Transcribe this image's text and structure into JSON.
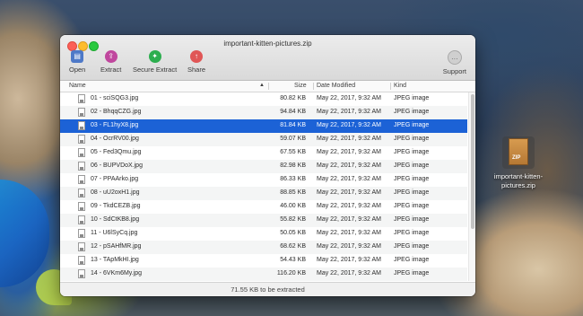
{
  "window": {
    "title": "important-kitten-pictures.zip"
  },
  "toolbar": {
    "open": "Open",
    "extract": "Extract",
    "secure_extract": "Secure Extract",
    "share": "Share",
    "support": "Support"
  },
  "columns": {
    "name": "Name",
    "size": "Size",
    "date": "Date Modified",
    "kind": "Kind"
  },
  "files": [
    {
      "name": "01 - sciSQG3.jpg",
      "size": "80.82 KB",
      "date": "May 22, 2017, 9:32 AM",
      "kind": "JPEG image"
    },
    {
      "name": "02 - BhqqCZG.jpg",
      "size": "94.84 KB",
      "date": "May 22, 2017, 9:32 AM",
      "kind": "JPEG image"
    },
    {
      "name": "03 - FL1hyX8.jpg",
      "size": "81.84 KB",
      "date": "May 22, 2017, 9:32 AM",
      "kind": "JPEG image"
    },
    {
      "name": "04 - OcrRV00.jpg",
      "size": "59.07 KB",
      "date": "May 22, 2017, 9:32 AM",
      "kind": "JPEG image"
    },
    {
      "name": "05 - Fed3Qmu.jpg",
      "size": "67.55 KB",
      "date": "May 22, 2017, 9:32 AM",
      "kind": "JPEG image"
    },
    {
      "name": "06 - BUPVDoX.jpg",
      "size": "82.98 KB",
      "date": "May 22, 2017, 9:32 AM",
      "kind": "JPEG image"
    },
    {
      "name": "07 - PPAArko.jpg",
      "size": "86.33 KB",
      "date": "May 22, 2017, 9:32 AM",
      "kind": "JPEG image"
    },
    {
      "name": "08 - uU2oxH1.jpg",
      "size": "88.85 KB",
      "date": "May 22, 2017, 9:32 AM",
      "kind": "JPEG image"
    },
    {
      "name": "09 - TkdCEZB.jpg",
      "size": "46.00 KB",
      "date": "May 22, 2017, 9:32 AM",
      "kind": "JPEG image"
    },
    {
      "name": "10 - SdCtKB8.jpg",
      "size": "55.82 KB",
      "date": "May 22, 2017, 9:32 AM",
      "kind": "JPEG image"
    },
    {
      "name": "11 - U6lSyCq.jpg",
      "size": "50.05 KB",
      "date": "May 22, 2017, 9:32 AM",
      "kind": "JPEG image"
    },
    {
      "name": "12 - pSAHfMR.jpg",
      "size": "68.62 KB",
      "date": "May 22, 2017, 9:32 AM",
      "kind": "JPEG image"
    },
    {
      "name": "13 - TApMkHI.jpg",
      "size": "54.43 KB",
      "date": "May 22, 2017, 9:32 AM",
      "kind": "JPEG image"
    },
    {
      "name": "14 - 6VKm6My.jpg",
      "size": "116.20 KB",
      "date": "May 22, 2017, 9:32 AM",
      "kind": "JPEG image"
    }
  ],
  "selected_index": 2,
  "status": "71.55 KB to be extracted",
  "desktop_icon": {
    "label": "ZIP",
    "name": "important-kitten-pictures.zip"
  },
  "colors": {
    "selection": "#1c62d6",
    "accent": "#4e79c8"
  },
  "icons": {
    "open": "open-folder-icon",
    "extract": "extract-icon",
    "secure_extract": "shield-icon",
    "share": "share-icon",
    "support": "support-icon",
    "file": "jpeg-file-icon"
  }
}
